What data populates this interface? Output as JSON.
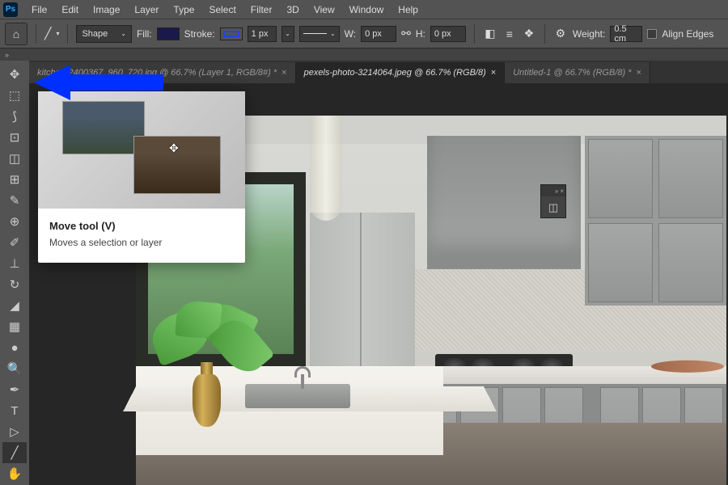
{
  "menu": {
    "items": [
      "File",
      "Edit",
      "Image",
      "Layer",
      "Type",
      "Select",
      "Filter",
      "3D",
      "View",
      "Window",
      "Help"
    ]
  },
  "options": {
    "shape": "Shape",
    "fill": "Fill:",
    "stroke": "Stroke:",
    "strokeW": "1 px",
    "w": "W:",
    "wVal": "0 px",
    "h": "H:",
    "hVal": "0 px",
    "weight": "Weight:",
    "weightVal": "0.5 cm",
    "alignEdges": "Align Edges"
  },
  "tabs": [
    {
      "label": "kitchen-2400367_960_720.jpg @ 66.7% (Layer 1, RGB/8#) *",
      "active": false
    },
    {
      "label": "pexels-photo-3214064.jpeg @ 66.7% (RGB/8)",
      "active": true
    },
    {
      "label": "Untitled-1 @ 66.7% (RGB/8) *",
      "active": false
    }
  ],
  "tooltip": {
    "title": "Move tool (V)",
    "desc": "Moves a selection or layer"
  },
  "collapse": "»"
}
